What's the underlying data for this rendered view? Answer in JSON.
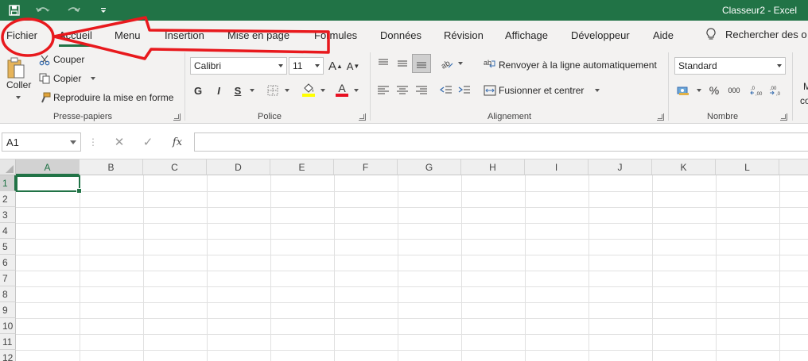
{
  "window": {
    "title": "Classeur2  -  Excel"
  },
  "tabs": [
    {
      "label": "Fichier"
    },
    {
      "label": "Accueil"
    },
    {
      "label": "Menu"
    },
    {
      "label": "Insertion"
    },
    {
      "label": "Mise en page"
    },
    {
      "label": "Formules"
    },
    {
      "label": "Données"
    },
    {
      "label": "Révision"
    },
    {
      "label": "Affichage"
    },
    {
      "label": "Développeur"
    },
    {
      "label": "Aide"
    }
  ],
  "tell_me": {
    "label": "Rechercher des o"
  },
  "ribbon": {
    "clipboard": {
      "paste": "Coller",
      "cut": "Couper",
      "copy": "Copier",
      "format_painter": "Reproduire la mise en forme",
      "label": "Presse-papiers"
    },
    "font": {
      "name": "Calibri",
      "size": "11",
      "bold": "G",
      "italic": "I",
      "underline": "S",
      "grow": "A",
      "shrink": "A",
      "color_letter": "A",
      "label": "Police"
    },
    "alignment": {
      "wrap": "Renvoyer à la ligne automatiquement",
      "merge": "Fusionner et centrer",
      "label": "Alignement"
    },
    "number": {
      "format": "Standard",
      "percent": "%",
      "thousands": "000",
      "label": "Nombre"
    },
    "partial": {
      "top": "M",
      "bottom": "co"
    }
  },
  "formula_bar": {
    "name_box": "A1",
    "cancel": "✕",
    "enter": "✓",
    "fx": "fx",
    "value": ""
  },
  "grid": {
    "columns": [
      "A",
      "B",
      "C",
      "D",
      "E",
      "F",
      "G",
      "H",
      "I",
      "J",
      "K",
      "L"
    ],
    "rows": [
      "1",
      "2",
      "3",
      "4",
      "5",
      "6",
      "7",
      "8",
      "9",
      "10",
      "11",
      "12"
    ]
  },
  "colors": {
    "brand": "#217346",
    "annotation": "#e8191d"
  }
}
